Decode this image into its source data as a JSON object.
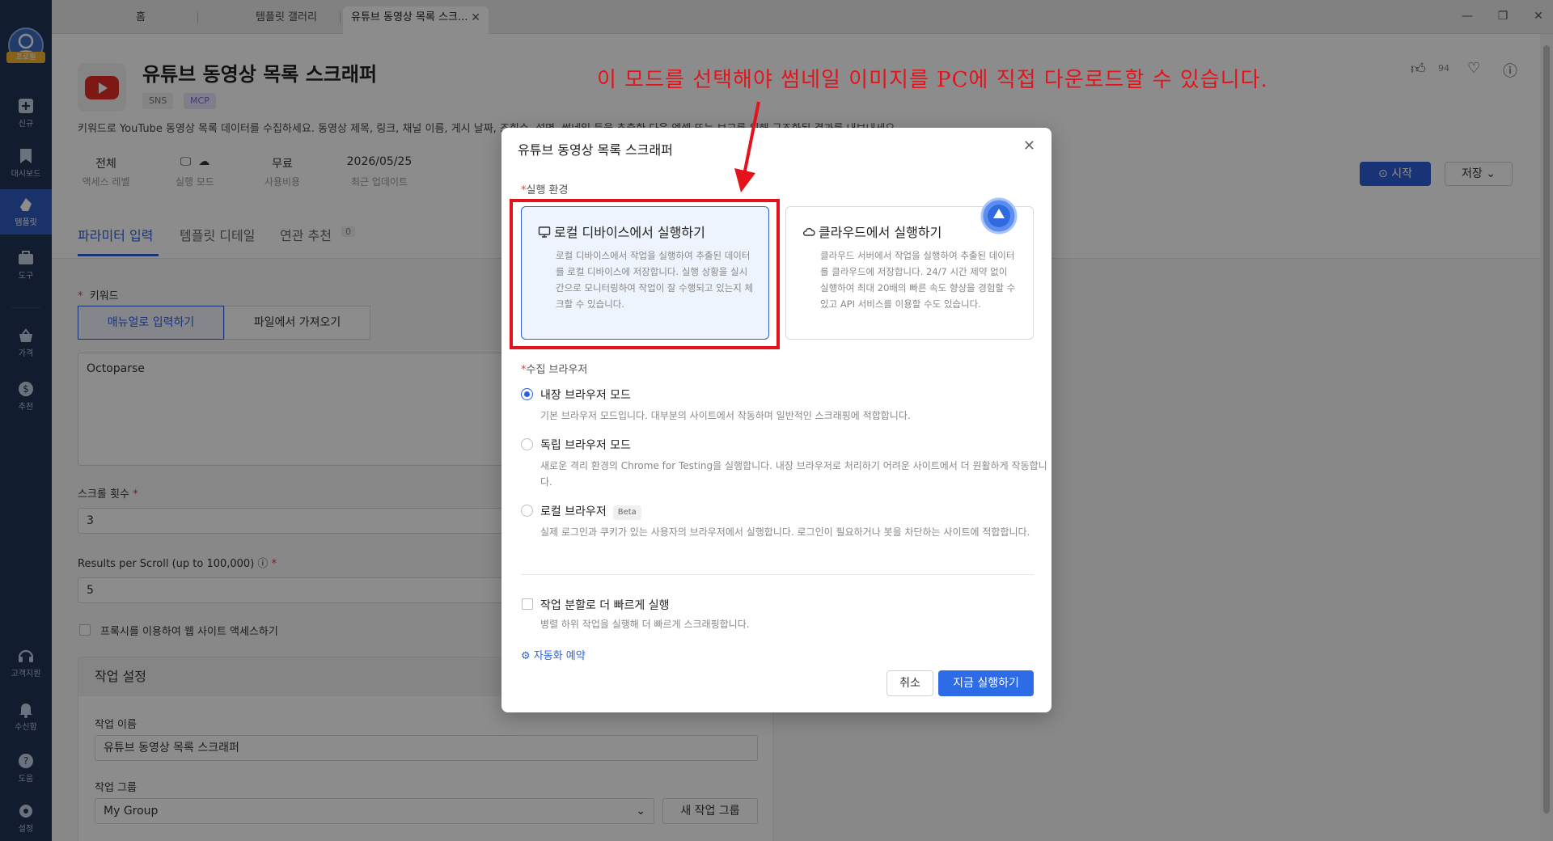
{
  "rail": {
    "avatar_badge": "프로필",
    "items": [
      {
        "label": "신규",
        "icon": "plus-square-icon"
      },
      {
        "label": "대시보드",
        "icon": "bookmark-icon"
      },
      {
        "label": "템플릿",
        "icon": "template-icon"
      },
      {
        "label": "도구",
        "icon": "toolbox-icon"
      },
      {
        "label": "가격",
        "icon": "basket-icon"
      },
      {
        "label": "추천",
        "icon": "dollar-icon"
      },
      {
        "label": "고객지원",
        "icon": "headset-icon"
      },
      {
        "label": "수신함",
        "icon": "bell-icon"
      },
      {
        "label": "도움",
        "icon": "help-icon"
      },
      {
        "label": "설정",
        "icon": "gear-icon"
      }
    ]
  },
  "tabs": [
    {
      "label": "홈"
    },
    {
      "label": "템플릿 갤러리"
    },
    {
      "label": "유튜브 동영상 목록 스크..."
    }
  ],
  "template": {
    "title": "유튜브 동영상 목록 스크래퍼",
    "tags": [
      "SNS",
      "MCP"
    ],
    "description": "키워드로 YouTube 동영상 목록 데이터를 수집하세요. 동영상 제목, 링크, 채널 이름, 게시 날짜, 조회수, 설명, 썸네일 등을 추출한 다음 엑셀 또는 보고를 위해 구조화된 결과를 내보내세요.",
    "like_count": "94",
    "meta": [
      {
        "value": "전체",
        "label": "액세스 레벨"
      },
      {
        "value": "",
        "label": "실행 모드"
      },
      {
        "value": "무료",
        "label": "사용비용"
      },
      {
        "value": "2026/05/25",
        "label": "최근 업데이트"
      }
    ],
    "start_label": "시작",
    "save_label": "저장"
  },
  "page_tabs": [
    {
      "label": "파라미터 입력"
    },
    {
      "label": "템플릿 디테일"
    },
    {
      "label": "연관 추천"
    }
  ],
  "related_count": "0",
  "params": {
    "keyword_label": "키워드",
    "manual_label": "매뉴얼로 입력하기",
    "file_label": "파일에서 가져오기",
    "keyword_value": "Octoparse",
    "scroll_label": "스크롤 횟수",
    "scroll_value": "3",
    "results_label": "Results per Scroll (up to 100,000)",
    "results_value": "5",
    "proxy_label": "프록시를 이용하여 웹 사이트 액세스하기"
  },
  "task": {
    "section_title": "작업 설정",
    "name_label": "작업 이름",
    "name_value": "유튜브 동영상 목록 스크래퍼",
    "group_label": "작업 그룹",
    "group_value": "My Group",
    "new_group_label": "새 작업 그룹"
  },
  "dialog": {
    "title": "유튜브 동영상 목록 스크래퍼",
    "env_label": "실행 환경",
    "env_options": [
      {
        "title": "로컬 디바이스에서 실행하기",
        "desc": "로컬 디바이스에서 작업을 실행하여 추출된 데이터를 로컬 디바이스에 저장합니다. 실행 상황을 실시간으로 모니터링하여 작업이 잘 수행되고 있는지 체크할 수 있습니다.",
        "selected": true
      },
      {
        "title": "클라우드에서 실행하기",
        "desc": "클라우드 서버에서 작업을 실행하여 추출된 데이터를 클라우드에 저장합니다. 24/7 시간 제약 없이 실행하여 최대 20배의 빠른 속도 향상을 경험할 수 있고 API 서비스를 이용할 수도 있습니다.",
        "selected": false
      }
    ],
    "browser_label": "수집 브라우저",
    "browser_options": [
      {
        "title": "내장 브라우저 모드",
        "desc": "기본 브라우저 모드입니다. 대부분의 사이트에서 작동하며 일반적인 스크래핑에 적합합니다.",
        "selected": true
      },
      {
        "title": "독립 브라우저 모드",
        "desc": "새로운 격리 환경의 Chrome for Testing을 실행합니다. 내장 브라우저로 처리하기 어려운 사이트에서 더 원활하게 작동합니다.",
        "selected": false
      },
      {
        "title": "로컬 브라우저",
        "badge": "Beta",
        "desc": "실제 로그인과 쿠키가 있는 사용자의 브라우저에서 실행합니다. 로그인이 필요하거나 봇을 차단하는 사이트에 적합합니다.",
        "selected": false
      }
    ],
    "split_label": "작업 분할로 더 빠르게 실행",
    "split_desc": "병렬 하위 작업을 실행해 더 빠르게 스크래핑합니다.",
    "schedule_label": "자동화 예약",
    "cancel_label": "취소",
    "run_label": "지금 실행하기"
  },
  "annotation": {
    "text": "이 모드를 선택해야 썸네일 이미지를 PC에 직접 다운로드할 수 있습니다.",
    "color": "#e4131b"
  },
  "colors": {
    "accent": "#2e5fd8",
    "rail": "#1f3356"
  }
}
